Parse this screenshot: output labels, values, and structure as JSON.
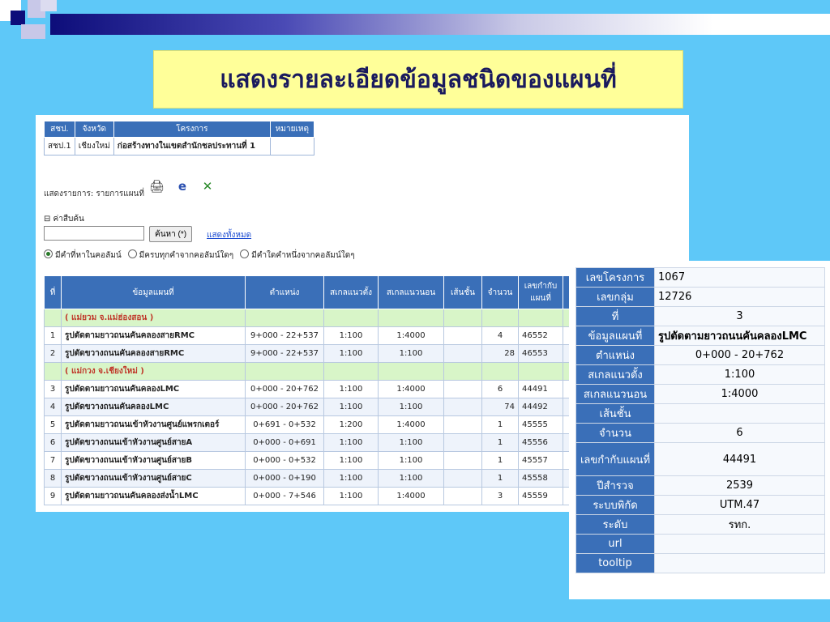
{
  "slide_title": "แสดงรายละเอียดข้อมูลชนิดของแผนที่",
  "project_table": {
    "headers": [
      "สชป.",
      "จังหวัด",
      "โครงการ",
      "หมายเหตุ"
    ],
    "row": [
      "สชป.1",
      "เชียงใหม่",
      "ก่อสร้างทางในเขตสำนักชลประทานที่ 1",
      ""
    ]
  },
  "list_label": "แสดงรายการ: รายการแผนที่",
  "search": {
    "label": "⊟ ค่าสืบค้น",
    "value": "",
    "button_label": "ค้นหา (*)",
    "show_all_label": "แสดงทั้งหมด",
    "options": [
      "มีคำที่หาในคอลัมน์",
      "มีครบทุกคำจากคอลัมน์ใดๆ",
      "มีคำใดคำหนึ่งจากคอลัมน์ใดๆ"
    ]
  },
  "map_table": {
    "headers": [
      "ที่",
      "ข้อมูลแผนที่",
      "ตำแหน่ง",
      "สเกลแนวตั้ง",
      "สเกลแนวนอน",
      "เส้นชั้น",
      "จำนวน",
      "เลขกำกับแผนที่"
    ],
    "group1": "( แม่ยวม จ.แม่ฮ่องสอน )",
    "group2": "( แม่กวง จ.เชียงใหม่ )",
    "rows": [
      [
        "1",
        "รูปตัดตามยาวถนนคันคลองสายRMC",
        "9+000 - 22+537",
        "1:100",
        "1:4000",
        "",
        "4",
        "46552"
      ],
      [
        "2",
        "รูปตัดขวางถนนคันคลองสายRMC",
        "9+000 - 22+537",
        "1:100",
        "1:100",
        "",
        "28",
        "46553"
      ],
      [
        "3",
        "รูปตัดตามยาวถนนคันคลองLMC",
        "0+000 - 20+762",
        "1:100",
        "1:4000",
        "",
        "6",
        "44491"
      ],
      [
        "4",
        "รูปตัดขวางถนนคันคลองLMC",
        "0+000 - 20+762",
        "1:100",
        "1:100",
        "",
        "74",
        "44492"
      ],
      [
        "5",
        "รูปตัดตามยาวถนนเข้าหัวงานศูนย์แพรกเตอร์",
        "0+691 - 0+532",
        "1:200",
        "1:4000",
        "",
        "1",
        "45555"
      ],
      [
        "6",
        "รูปตัดขวางถนนเข้าหัวงานศูนย์สายA",
        "0+000 - 0+691",
        "1:100",
        "1:100",
        "",
        "1",
        "45556"
      ],
      [
        "7",
        "รูปตัดขวางถนนเข้าหัวงานศูนย์สายB",
        "0+000 - 0+532",
        "1:100",
        "1:100",
        "",
        "1",
        "45557"
      ],
      [
        "8",
        "รูปตัดขวางถนนเข้าหัวงานศูนย์สายC",
        "0+000 - 0+190",
        "1:100",
        "1:100",
        "",
        "1",
        "45558"
      ],
      [
        "9",
        "รูปตัดตามยาวถนนคันคลองส่งน้ำLMC",
        "0+000 - 7+546",
        "1:100",
        "1:4000",
        "",
        "3",
        "45559"
      ]
    ]
  },
  "detail": {
    "project_no_label": "เลขโครงการ",
    "project_no": "1067",
    "group_no_label": "เลขกลุ่ม",
    "group_no": "12726",
    "index_label": "ที่",
    "index": "3",
    "map_info_label": "ข้อมูลแผนที่",
    "map_info": "รูปตัดตามยาวถนนคันคลองLMC",
    "position_label": "ตำแหน่ง",
    "position": "0+000 - 20+762",
    "vscale_label": "สเกลแนวตั้ง",
    "vscale": "1:100",
    "hscale_label": "สเกลแนวนอน",
    "hscale": "1:4000",
    "contour_label": "เส้นชั้น",
    "contour": "",
    "count_label": "จำนวน",
    "count": "6",
    "map_no_label": "เลขกำกับแผนที่",
    "map_no": "44491",
    "survey_year_label": "ปีสำรวจ",
    "survey_year": "2539",
    "coord_label": "ระบบพิกัด",
    "coord": "UTM.47",
    "level_label": "ระดับ",
    "level": "รทก.",
    "url_label": "url",
    "url": "",
    "tooltip_label": "tooltip",
    "tooltip": ""
  },
  "colors": {
    "background": "#5ec8f8",
    "title_bg": "#ffff99",
    "header_blue": "#3a6fb8",
    "group_green": "#d8f5c8"
  }
}
